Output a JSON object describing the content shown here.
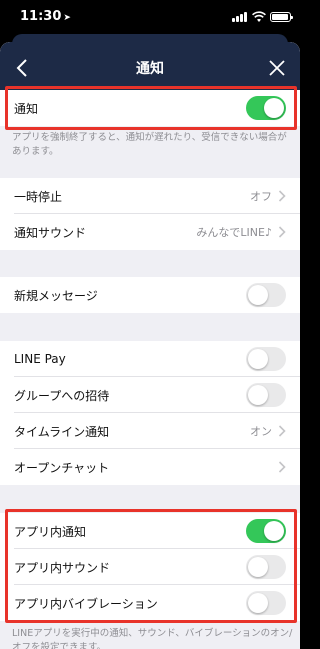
{
  "status_bar": {
    "time": "11:30",
    "icons": [
      "location-arrow-icon",
      "signal-icon",
      "wifi-icon",
      "battery-icon"
    ]
  },
  "nav": {
    "title": "通知",
    "back_icon": "chevron-left-icon",
    "close_icon": "close-icon"
  },
  "rows": {
    "notify": {
      "label": "通知",
      "on": true
    },
    "notify_note": "アプリを強制終了すると、通知が遅れたり、受信できない場合があります。",
    "pause": {
      "label": "一時停止",
      "value": "オフ"
    },
    "sound": {
      "label": "通知サウンド",
      "value": "みんなでLINE♪"
    },
    "new_message": {
      "label": "新規メッセージ",
      "on": false
    },
    "line_pay": {
      "label": "LINE Pay",
      "on": false
    },
    "group_invite": {
      "label": "グループへの招待",
      "on": false
    },
    "timeline": {
      "label": "タイムライン通知",
      "value": "オン"
    },
    "open_chat": {
      "label": "オープンチャット"
    },
    "in_app": {
      "label": "アプリ内通知",
      "on": true
    },
    "in_app_sound": {
      "label": "アプリ内サウンド",
      "on": false
    },
    "in_app_vibration": {
      "label": "アプリ内バイブレーション",
      "on": false
    },
    "bottom_note": "LINEアプリを実行中の通知、サウンド、バイブレーションのオン/オフを設定できます。"
  },
  "colors": {
    "nav": "#1d2a46",
    "toggle_on": "#34c759",
    "highlight": "#e8332a",
    "background": "#efeff4"
  }
}
